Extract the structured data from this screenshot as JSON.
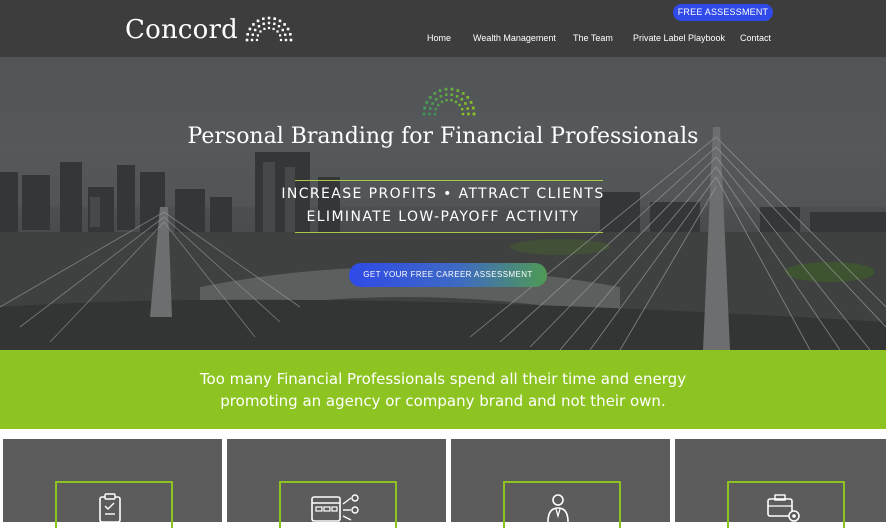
{
  "header": {
    "logo_text": "Concord",
    "cta_label": "FREE ASSESSMENT",
    "nav": [
      {
        "label": "Home"
      },
      {
        "label": "Wealth Management"
      },
      {
        "label": "The Team"
      },
      {
        "label": "Private Label Playbook"
      },
      {
        "label": "Contact"
      }
    ]
  },
  "hero": {
    "title": "Personal Branding for Financial Professionals",
    "line1": "INCREASE PROFITS  •  ATTRACT CLIENTS",
    "line2": "ELIMINATE LOW-PAYOFF ACTIVITY",
    "button_label": "GET YOUR FREE CAREER ASSESSMENT"
  },
  "band": {
    "line1": "Too many Financial Professionals spend all their time and energy",
    "line2": "promoting an agency or company brand and not their own."
  },
  "cards": [
    {
      "icon": "clipboard-icon"
    },
    {
      "icon": "dashboard-icon"
    },
    {
      "icon": "advisor-icon"
    },
    {
      "icon": "briefcase-gear-icon"
    }
  ],
  "colors": {
    "accent_green": "#8dc421",
    "cta_blue": "#2f4ae8",
    "header_bg": "#3d3d3d",
    "card_bg": "#5c5c5c"
  }
}
